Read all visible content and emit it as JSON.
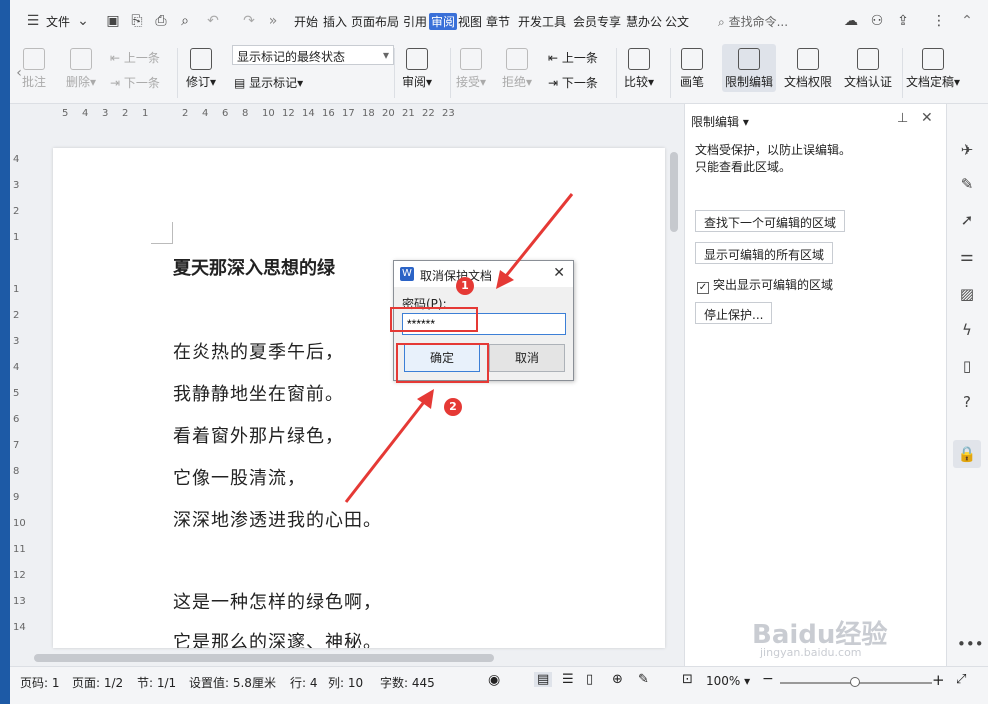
{
  "menubar": {
    "file_label": "文件",
    "tabs": [
      "开始",
      "插入",
      "页面布局",
      "引用",
      "审阅",
      "视图",
      "章节",
      "开发工具",
      "会员专享",
      "慧办公",
      "公文"
    ],
    "active_tab": "审阅",
    "search_placeholder": "查找命令..."
  },
  "ribbon": {
    "comment": "批注",
    "delete": "删除",
    "prev_comment": "上一条",
    "next_comment": "下一条",
    "revise": "修订",
    "markup_state": "显示标记的最终状态",
    "show_markup": "显示标记",
    "review": "审阅",
    "accept": "接受",
    "reject": "拒绝",
    "prev_change": "上一条",
    "next_change": "下一条",
    "compare": "比较",
    "pen": "画笔",
    "restrict_edit": "限制编辑",
    "doc_permission": "文档权限",
    "doc_cert": "文档认证",
    "doc_finalize": "文档定稿"
  },
  "ruler": {
    "h_ticks": [
      "5",
      "4",
      "3",
      "2",
      "1",
      "",
      "2",
      "4",
      "6",
      "8",
      "10",
      "12",
      "14",
      "16",
      "17",
      "18",
      "20",
      "21",
      "22",
      "23"
    ],
    "v_ticks": [
      "4",
      "3",
      "2",
      "1",
      "",
      "1",
      "2",
      "3",
      "4",
      "5",
      "6",
      "7",
      "8",
      "9",
      "10",
      "11",
      "12",
      "13",
      "14"
    ]
  },
  "document": {
    "title": "夏天那深入思想的绿",
    "lines": [
      "在炎热的夏季午后，",
      "我静静地坐在窗前。",
      "看着窗外那片绿色，",
      "它像一股清流，",
      "深深地渗透进我的心田。",
      "",
      "这是一种怎样的绿色啊，",
      "它是那么的深邃、神秘。"
    ]
  },
  "dialog": {
    "title": "取消保护文档",
    "password_label": "密码(P):",
    "password_value": "******",
    "ok": "确定",
    "cancel": "取消"
  },
  "annotations": {
    "badge1": "1",
    "badge2": "2"
  },
  "panel": {
    "title": "限制编辑",
    "description": "文档受保护，以防止误编辑。\n只能查看此区域。",
    "find_next": "查找下一个可编辑的区域",
    "show_all": "显示可编辑的所有区域",
    "highlight": "突出显示可编辑的区域",
    "stop": "停止保护..."
  },
  "statusbar": {
    "page_code": "页码: 1",
    "pages": "页面: 1/2",
    "section": "节: 1/1",
    "setting": "设置值: 5.8厘米",
    "row": "行: 4",
    "col": "列: 10",
    "words": "字数: 445",
    "zoom": "100%"
  },
  "watermark": {
    "brand": "Baidu经验",
    "url": "jingyan.baidu.com"
  },
  "colors": {
    "accent": "#3a70d8",
    "annotation": "#e53935"
  }
}
